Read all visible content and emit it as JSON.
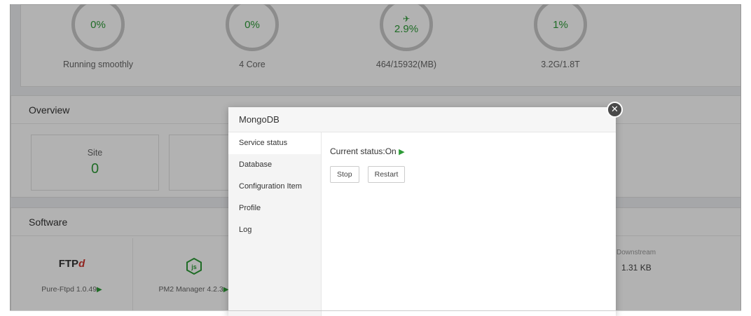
{
  "stats": [
    {
      "value": "0%",
      "label": "Running smoothly"
    },
    {
      "value": "0%",
      "label": "4 Core"
    },
    {
      "value": "2.9%",
      "label": "464/15932(MB)"
    },
    {
      "value": "1%",
      "label": "3.2G/1.8T"
    }
  ],
  "overview": {
    "title": "Overview",
    "site_label": "Site",
    "site_value": "0"
  },
  "software": {
    "title": "Software",
    "items": [
      {
        "logo": "FTP",
        "name": "Pure-Ftpd 1.0.49"
      },
      {
        "logo": "js",
        "name": "PM2 Manager 4.2.3"
      }
    ],
    "net_label": "Downstream",
    "net_value": "1.31 KB"
  },
  "modal": {
    "title": "MongoDB",
    "menu": [
      "Service status",
      "Database",
      "Configuration Item",
      "Profile",
      "Log"
    ],
    "status_text": "Current status:On",
    "stop_label": "Stop",
    "restart_label": "Restart"
  },
  "icons": {
    "close": "close-icon",
    "play": "play-icon",
    "rocket": "rocket-icon",
    "nodejs": "nodejs-icon"
  },
  "colors": {
    "accent": "#2d9b37",
    "ftp_red": "#d0352e",
    "downstream": "#2f6fc7"
  }
}
